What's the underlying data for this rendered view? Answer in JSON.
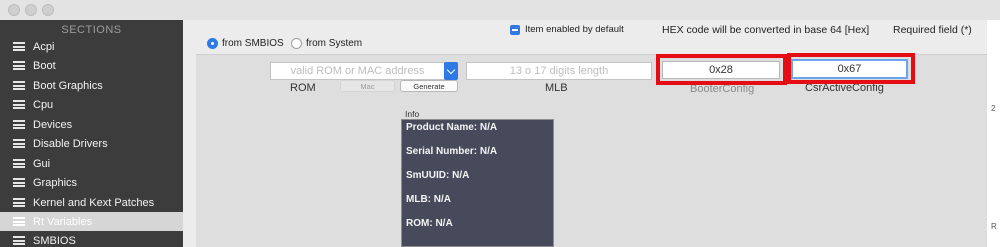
{
  "sidebar": {
    "header": "SECTIONS",
    "items": [
      {
        "label": "Acpi"
      },
      {
        "label": "Boot"
      },
      {
        "label": "Boot Graphics"
      },
      {
        "label": "Cpu"
      },
      {
        "label": "Devices"
      },
      {
        "label": "Disable Drivers"
      },
      {
        "label": "Gui"
      },
      {
        "label": "Graphics"
      },
      {
        "label": "Kernel and Kext Patches"
      },
      {
        "label": "Rt Variables",
        "selected": true
      },
      {
        "label": "SMBIOS"
      }
    ]
  },
  "source": {
    "from_smbios": "from SMBIOS",
    "from_system": "from System",
    "selected": "from SMBIOS"
  },
  "header": {
    "item_enabled": "Item enabled by default",
    "hex_note": "HEX code will be converted in base 64 [Hex]",
    "required": "Required field (*)"
  },
  "fields": {
    "rom_placeholder": "valid ROM or MAC address",
    "rom_label": "ROM",
    "mac_button": "Mac",
    "generate_button": "Generate",
    "mlb_placeholder": "13 o 17 digits length",
    "mlb_label": "MLB",
    "booter_value": "0x28",
    "booter_label": "BooterConfig",
    "csr_value": "0x67",
    "csr_label": "CsrActiveConfig"
  },
  "info": {
    "label": "Info",
    "lines": [
      "Product Name: N/A",
      "Serial Number: N/A",
      "SmUUID: N/A",
      "MLB: N/A",
      "ROM: N/A"
    ]
  },
  "edge": [
    "2",
    "R"
  ],
  "colors": {
    "accent": "#2f7ae5",
    "highlight": "#e50c14",
    "sidebar_bg": "#3c3c3c",
    "info_bg": "#464a5a"
  }
}
